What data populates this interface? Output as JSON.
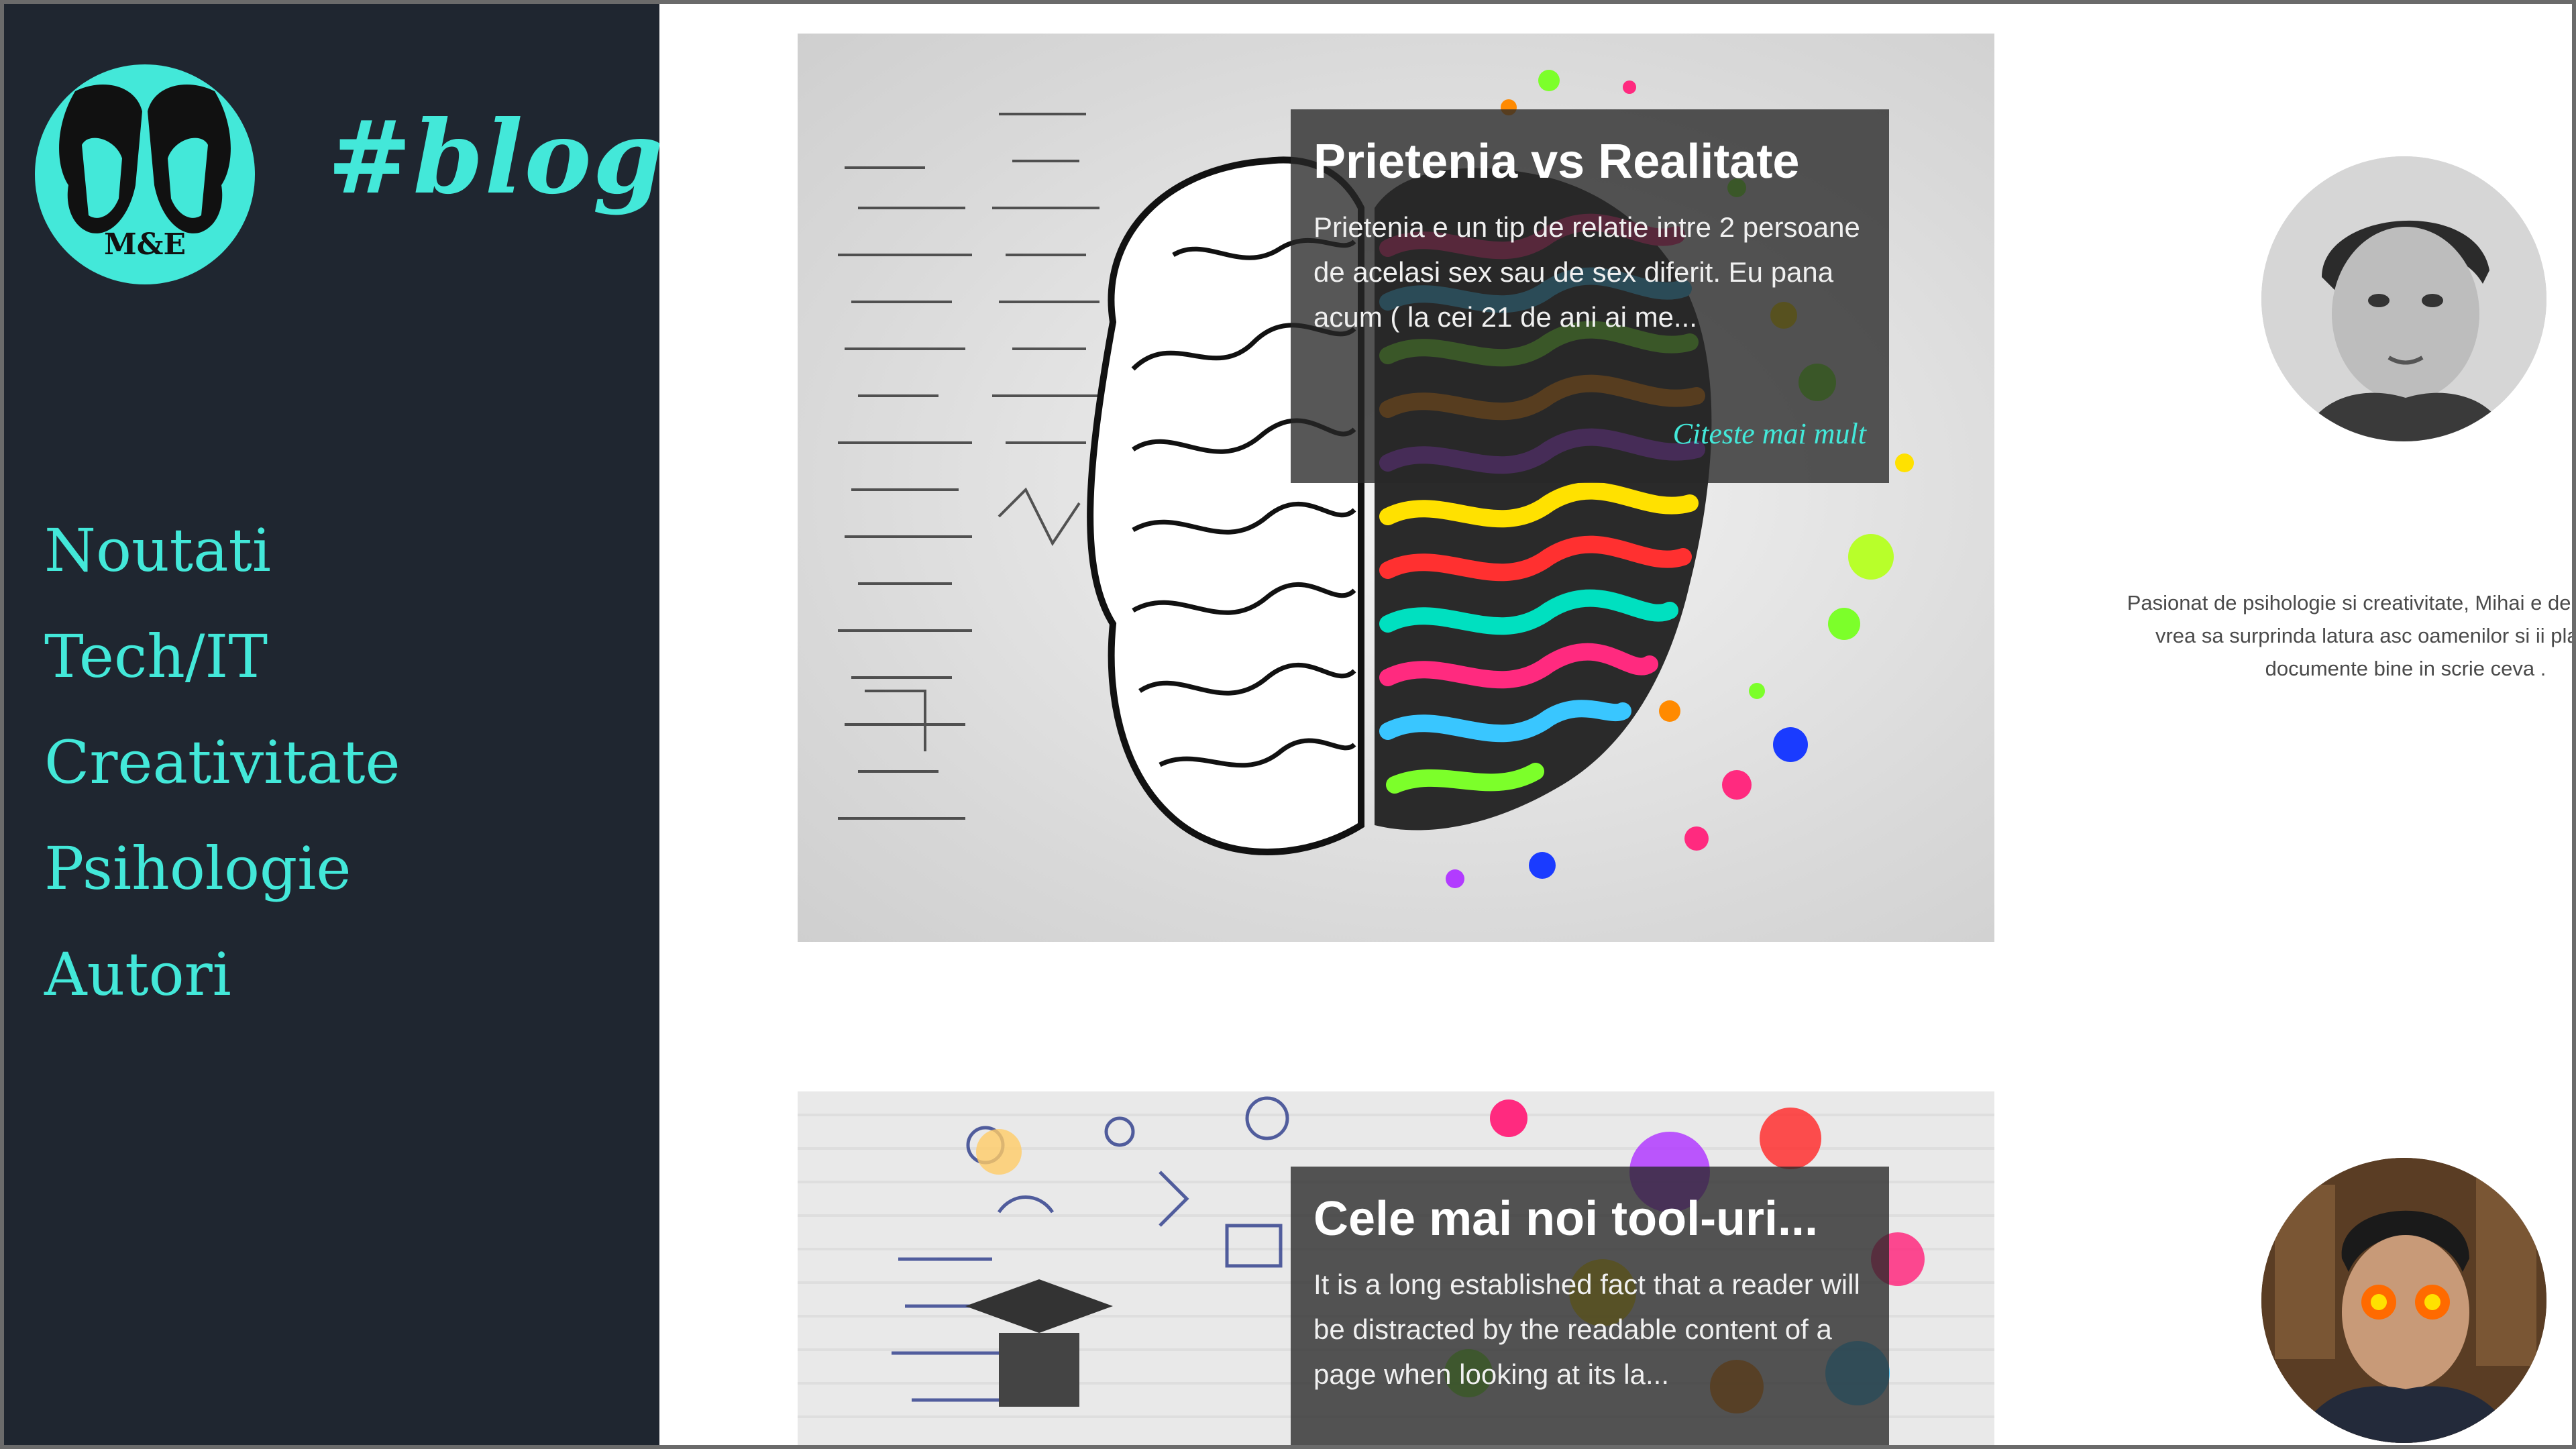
{
  "sidebar": {
    "logo_text": "M&E",
    "blog_title": "#blog",
    "nav": [
      "Noutati",
      "Tech/IT",
      "Creativitate",
      "Psihologie",
      "Autori"
    ]
  },
  "posts": [
    {
      "title": "Prietenia vs Realitate",
      "excerpt": "Prietenia e un tip de relatie intre 2 persoane de acelasi sex sau de sex diferit. Eu pana acum ( la cei 21 de ani ai me...",
      "read_more": "Citeste mai mult"
    },
    {
      "title": "Cele mai noi tool-uri...",
      "excerpt": "It is a long established fact that a reader will be distracted by the readable content of a page when looking at its la..."
    }
  ],
  "author": {
    "bio": "Pasionat de psihologie si creativitate, Mihai e de scriitor care vrea sa surprinda latura asc oamenilor si ii place sa se documente bine in scrie ceva ."
  },
  "colors": {
    "accent": "#43e8d9",
    "sidebar_bg": "#1f2630"
  }
}
